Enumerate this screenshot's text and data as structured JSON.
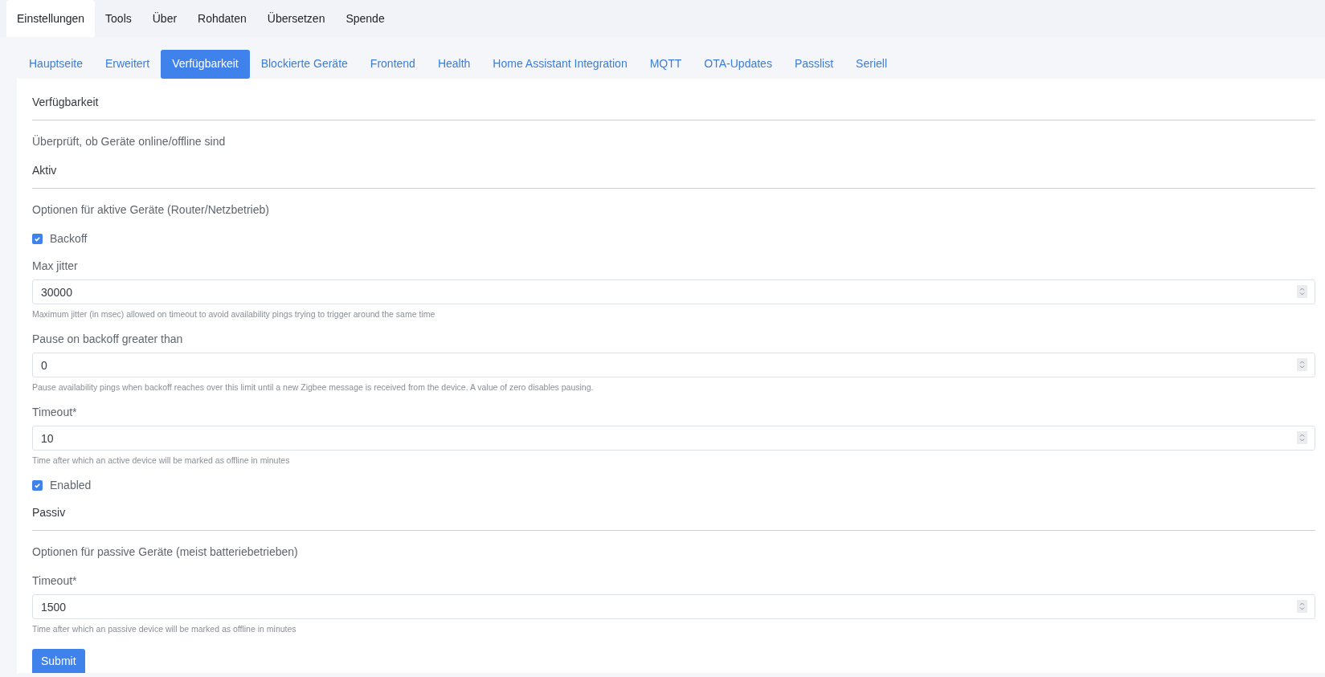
{
  "top_tabs": [
    {
      "label": "Einstellungen",
      "selected": true
    },
    {
      "label": "Tools",
      "selected": false
    },
    {
      "label": "Über",
      "selected": false
    },
    {
      "label": "Rohdaten",
      "selected": false
    },
    {
      "label": "Übersetzen",
      "selected": false
    },
    {
      "label": "Spende",
      "selected": false
    }
  ],
  "sub_tabs": [
    {
      "label": "Hauptseite",
      "selected": false
    },
    {
      "label": "Erweitert",
      "selected": false
    },
    {
      "label": "Verfügbarkeit",
      "selected": true
    },
    {
      "label": "Blockierte Geräte",
      "selected": false
    },
    {
      "label": "Frontend",
      "selected": false
    },
    {
      "label": "Health",
      "selected": false
    },
    {
      "label": "Home Assistant Integration",
      "selected": false
    },
    {
      "label": "MQTT",
      "selected": false
    },
    {
      "label": "OTA-Updates",
      "selected": false
    },
    {
      "label": "Passlist",
      "selected": false
    },
    {
      "label": "Seriell",
      "selected": false
    }
  ],
  "form": {
    "items": [
      {
        "kind": "section_title",
        "text": "Verfügbarkeit"
      },
      {
        "kind": "description",
        "text": "Überprüft, ob Geräte online/offline sind"
      },
      {
        "kind": "section_title",
        "text": "Aktiv"
      },
      {
        "kind": "description",
        "text": "Optionen für aktive Geräte (Router/Netzbetrieb)"
      },
      {
        "kind": "checkbox",
        "label": "Backoff",
        "checked": true
      },
      {
        "kind": "number",
        "label": "Max jitter",
        "value": "30000",
        "help": "Maximum jitter (in msec) allowed on timeout to avoid availability pings trying to trigger around the same time"
      },
      {
        "kind": "number",
        "label": "Pause on backoff greater than",
        "value": "0",
        "help": "Pause availability pings when backoff reaches over this limit until a new Zigbee message is received from the device. A value of zero disables pausing."
      },
      {
        "kind": "number",
        "label": "Timeout*",
        "value": "10",
        "help": "Time after which an active device will be marked as offline in minutes"
      },
      {
        "kind": "checkbox",
        "label": "Enabled",
        "checked": true
      },
      {
        "kind": "section_title",
        "text": "Passiv"
      },
      {
        "kind": "description",
        "text": "Optionen für passive Geräte (meist batteriebetrieben)"
      },
      {
        "kind": "number",
        "label": "Timeout*",
        "value": "1500",
        "help": "Time after which an passive device will be marked as offline in minutes"
      }
    ],
    "submit": "Submit"
  }
}
